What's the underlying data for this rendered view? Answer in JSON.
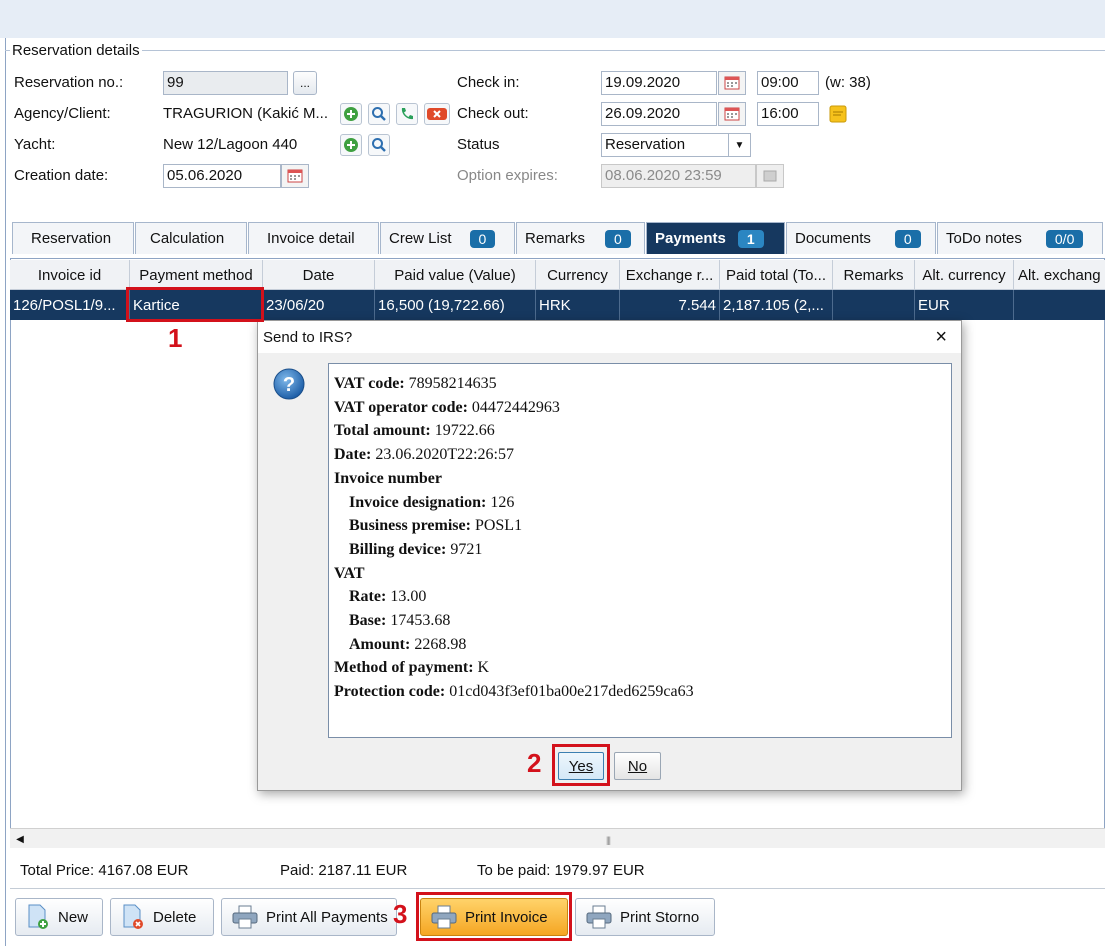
{
  "reservation_details": {
    "group_title": "Reservation details",
    "labels": {
      "reservation_no": "Reservation no.:",
      "agency_client": "Agency/Client:",
      "yacht": "Yacht:",
      "creation_date": "Creation date:",
      "check_in": "Check in:",
      "check_out": "Check out:",
      "status": "Status",
      "option_expires": "Option expires:"
    },
    "reservation_no": "99",
    "ellipsis_button": "...",
    "agency_client": "TRAGURION (Kakić M...",
    "yacht": "New 12/Lagoon 440",
    "creation_date": "05.06.2020",
    "check_in_date": "19.09.2020",
    "check_in_time": "09:00",
    "week": "(w: 38)",
    "check_out_date": "26.09.2020",
    "check_out_time": "16:00",
    "status": "Reservation",
    "option_expires": "08.06.2020 23:59"
  },
  "tabs": [
    {
      "label": "Reservation",
      "badge": ""
    },
    {
      "label": "Calculation",
      "badge": ""
    },
    {
      "label": "Invoice detail",
      "badge": ""
    },
    {
      "label": "Crew List",
      "badge": "0"
    },
    {
      "label": "Remarks",
      "badge": "0"
    },
    {
      "label": "Payments",
      "badge": "1"
    },
    {
      "label": "Documents",
      "badge": "0"
    },
    {
      "label": "ToDo notes",
      "badge": "0/0"
    }
  ],
  "grid": {
    "columns": [
      "Invoice id",
      "Payment method",
      "Date",
      "Paid value (Value)",
      "Currency",
      "Exchange r...",
      "Paid total (To...",
      "Remarks",
      "Alt. currency",
      "Alt. exchang"
    ],
    "rows": [
      [
        "126/POSL1/9...",
        "Kartice",
        "23/06/20",
        "16,500 (19,722.66)",
        "HRK",
        "7.544",
        "2,187.105 (2,...",
        "",
        "EUR",
        ""
      ]
    ]
  },
  "totals": {
    "total_price": "Total Price: 4167.08 EUR",
    "paid": "Paid: 2187.11 EUR",
    "to_be_paid": "To be paid: 1979.97 EUR"
  },
  "buttons": {
    "new": "New",
    "delete": "Delete",
    "print_all": "Print All Payments",
    "print_invoice": "Print Invoice",
    "print_storno": "Print Storno"
  },
  "dialog": {
    "title": "Send to IRS?",
    "close": "×",
    "lines": [
      {
        "key": "VAT code:",
        "value": " 78958214635"
      },
      {
        "key": "VAT operator code:",
        "value": " 04472442963"
      },
      {
        "key": "Total amount:",
        "value": " 19722.66"
      },
      {
        "key": "Date:",
        "value": " 23.06.2020T22:26:57"
      },
      {
        "key": "Invoice number",
        "value": ""
      },
      {
        "key": "Invoice designation:",
        "value": " 126"
      },
      {
        "key": "Business premise:",
        "value": " POSL1"
      },
      {
        "key": "Billing device:",
        "value": " 9721"
      },
      {
        "key": "VAT",
        "value": ""
      },
      {
        "key": "Rate:",
        "value": " 13.00"
      },
      {
        "key": "Base:",
        "value": " 17453.68"
      },
      {
        "key": "Amount:",
        "value": " 2268.98"
      },
      {
        "key": "Method of payment:",
        "value": " K"
      },
      {
        "key": "Protection code:",
        "value": " 01cd043f3ef01ba00e217ded6259ca63"
      }
    ],
    "yes": "Yes",
    "no": "No"
  },
  "annotations": {
    "m1": "1",
    "m2": "2",
    "m3": "3"
  },
  "colors": {
    "selection": "#16385f",
    "highlight": "#d3111b",
    "primary_button": "#f5a623"
  }
}
